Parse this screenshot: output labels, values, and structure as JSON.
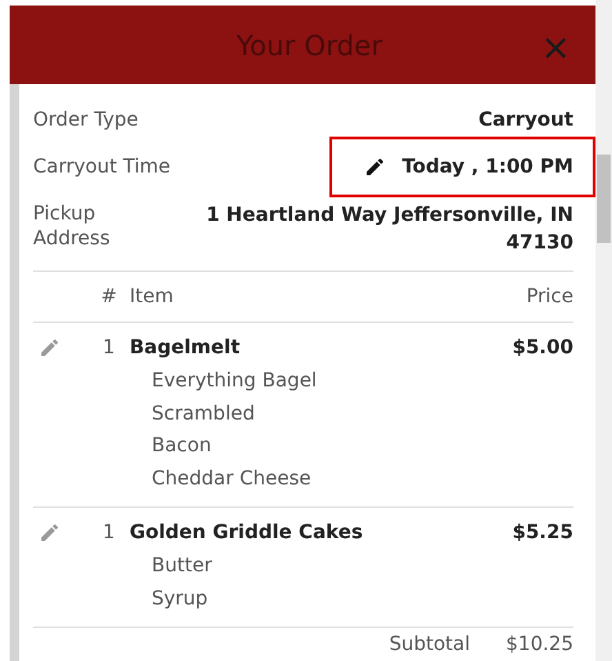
{
  "header": {
    "title": "Your Order",
    "close": "×"
  },
  "details": [
    {
      "label": "Order Type",
      "value": "Carryout",
      "editable": false,
      "highlighted": false
    },
    {
      "label": "Carryout Time",
      "value": "Today , 1:00 PM",
      "editable": true,
      "highlighted": true
    },
    {
      "label": "Pickup Address",
      "value": "1 Heartland Way Jeffersonville, IN 47130",
      "editable": false,
      "highlighted": false
    }
  ],
  "table": {
    "columns": [
      "#",
      "Item",
      "Price"
    ],
    "rows": [
      {
        "qty": "1",
        "name": "Bagelmelt",
        "price": "$5.00",
        "editable": true,
        "modifiers": [
          "Everything Bagel",
          "Scrambled",
          "Bacon",
          "Cheddar Cheese"
        ]
      },
      {
        "qty": "1",
        "name": "Golden Griddle Cakes",
        "price": "$5.25",
        "editable": true,
        "modifiers": [
          "Butter",
          "Syrup"
        ]
      }
    ]
  },
  "subtotal": {
    "label": "Subtotal",
    "value": "$10.25"
  }
}
